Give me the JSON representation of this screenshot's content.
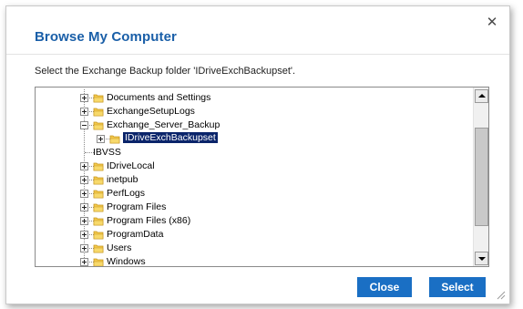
{
  "dialog": {
    "title": "Browse My Computer",
    "close_icon": "close-icon",
    "instruction": "Select the Exchange Backup folder 'IDriveExchBackupset'."
  },
  "tree": {
    "items": [
      {
        "label": "Documents and Settings",
        "level": 0,
        "expander": "plus",
        "selected": false
      },
      {
        "label": "ExchangeSetupLogs",
        "level": 0,
        "expander": "plus",
        "selected": false
      },
      {
        "label": "Exchange_Server_Backup",
        "level": 0,
        "expander": "minus",
        "selected": false
      },
      {
        "label": "IDriveExchBackupset",
        "level": 1,
        "expander": "plus",
        "selected": true
      },
      {
        "label": "IBVSS",
        "level": 0,
        "expander": "none",
        "selected": false
      },
      {
        "label": "IDriveLocal",
        "level": 0,
        "expander": "plus",
        "selected": false
      },
      {
        "label": "inetpub",
        "level": 0,
        "expander": "plus",
        "selected": false
      },
      {
        "label": "PerfLogs",
        "level": 0,
        "expander": "plus",
        "selected": false
      },
      {
        "label": "Program Files",
        "level": 0,
        "expander": "plus",
        "selected": false
      },
      {
        "label": "Program Files (x86)",
        "level": 0,
        "expander": "plus",
        "selected": false
      },
      {
        "label": "ProgramData",
        "level": 0,
        "expander": "plus",
        "selected": false
      },
      {
        "label": "Users",
        "level": 0,
        "expander": "plus",
        "selected": false
      },
      {
        "label": "Windows",
        "level": 0,
        "expander": "plus",
        "selected": false
      }
    ],
    "folder_icon": "folder-icon",
    "colors": {
      "folder_fill": "#f2c84b",
      "folder_edge": "#c7961f",
      "selection": "#0a246a"
    }
  },
  "buttons": {
    "close_label": "Close",
    "select_label": "Select",
    "color": "#1a6fc4"
  }
}
